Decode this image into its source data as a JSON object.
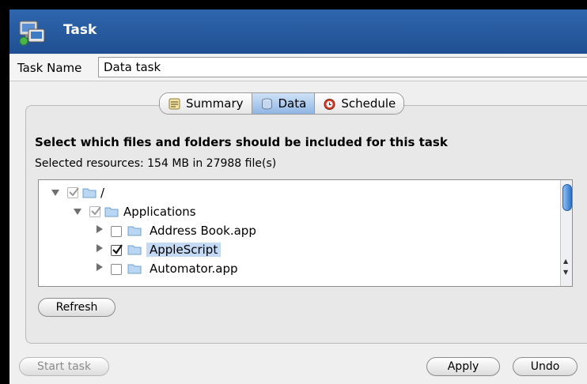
{
  "window": {
    "title": "Task"
  },
  "task_name": {
    "label": "Task Name",
    "value": "Data task"
  },
  "tabs": [
    {
      "label": "Summary",
      "icon": "summary-icon",
      "active": false
    },
    {
      "label": "Data",
      "icon": "data-icon",
      "active": true
    },
    {
      "label": "Schedule",
      "icon": "schedule-icon",
      "active": false
    }
  ],
  "data_panel": {
    "heading": "Select which files and folders should be included for this task",
    "summary": "Selected resources: 154 MB in 27988 file(s)",
    "tree": [
      {
        "label": "/",
        "level": 0,
        "expanded": true,
        "checked": true,
        "partial": true,
        "selected": false
      },
      {
        "label": "Applications",
        "level": 1,
        "expanded": true,
        "checked": true,
        "partial": true,
        "selected": false
      },
      {
        "label": "Address Book.app",
        "level": 2,
        "expanded": false,
        "checked": false,
        "partial": false,
        "selected": false
      },
      {
        "label": "AppleScript",
        "level": 2,
        "expanded": false,
        "checked": true,
        "partial": false,
        "selected": true
      },
      {
        "label": "Automator.app",
        "level": 2,
        "expanded": false,
        "checked": false,
        "partial": false,
        "selected": false
      }
    ],
    "refresh_label": "Refresh"
  },
  "footer": {
    "start_label": "Start task",
    "apply_label": "Apply",
    "undo_label": "Undo"
  },
  "colors": {
    "titlebar": "#2a5fa8",
    "selection": "#c4d9f3"
  }
}
